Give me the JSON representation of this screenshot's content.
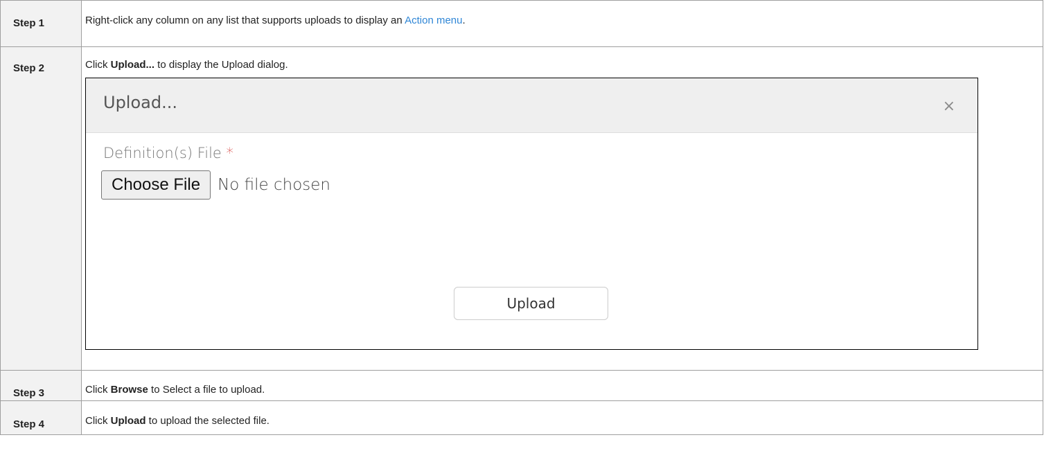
{
  "steps": [
    {
      "label": "Step 1",
      "text_before": "Right-click any column on any list that supports uploads to display an ",
      "link": "Action menu",
      "text_after": "."
    },
    {
      "label": "Step 2",
      "text_before": "Click ",
      "bold": "Upload...",
      "text_after": " to display the Upload dialog."
    },
    {
      "label": "Step 3",
      "text_before": "Click ",
      "bold": "Browse",
      "text_after": " to Select a file to upload."
    },
    {
      "label": "Step 4",
      "text_before": "Click ",
      "bold": "Upload",
      "text_after": " to upload the selected file."
    }
  ],
  "dialog": {
    "title": "Upload...",
    "close_icon": "close-icon",
    "close_glyph": "×",
    "field_label": "Definition(s) File",
    "required_mark": "*",
    "choose_button": "Choose File",
    "no_file_text": "No file chosen",
    "upload_button": "Upload"
  },
  "colors": {
    "link": "#2f86d6",
    "required": "#d9534f",
    "label_cell_bg": "#f2f2f2",
    "dialog_header_bg": "#efefef"
  }
}
